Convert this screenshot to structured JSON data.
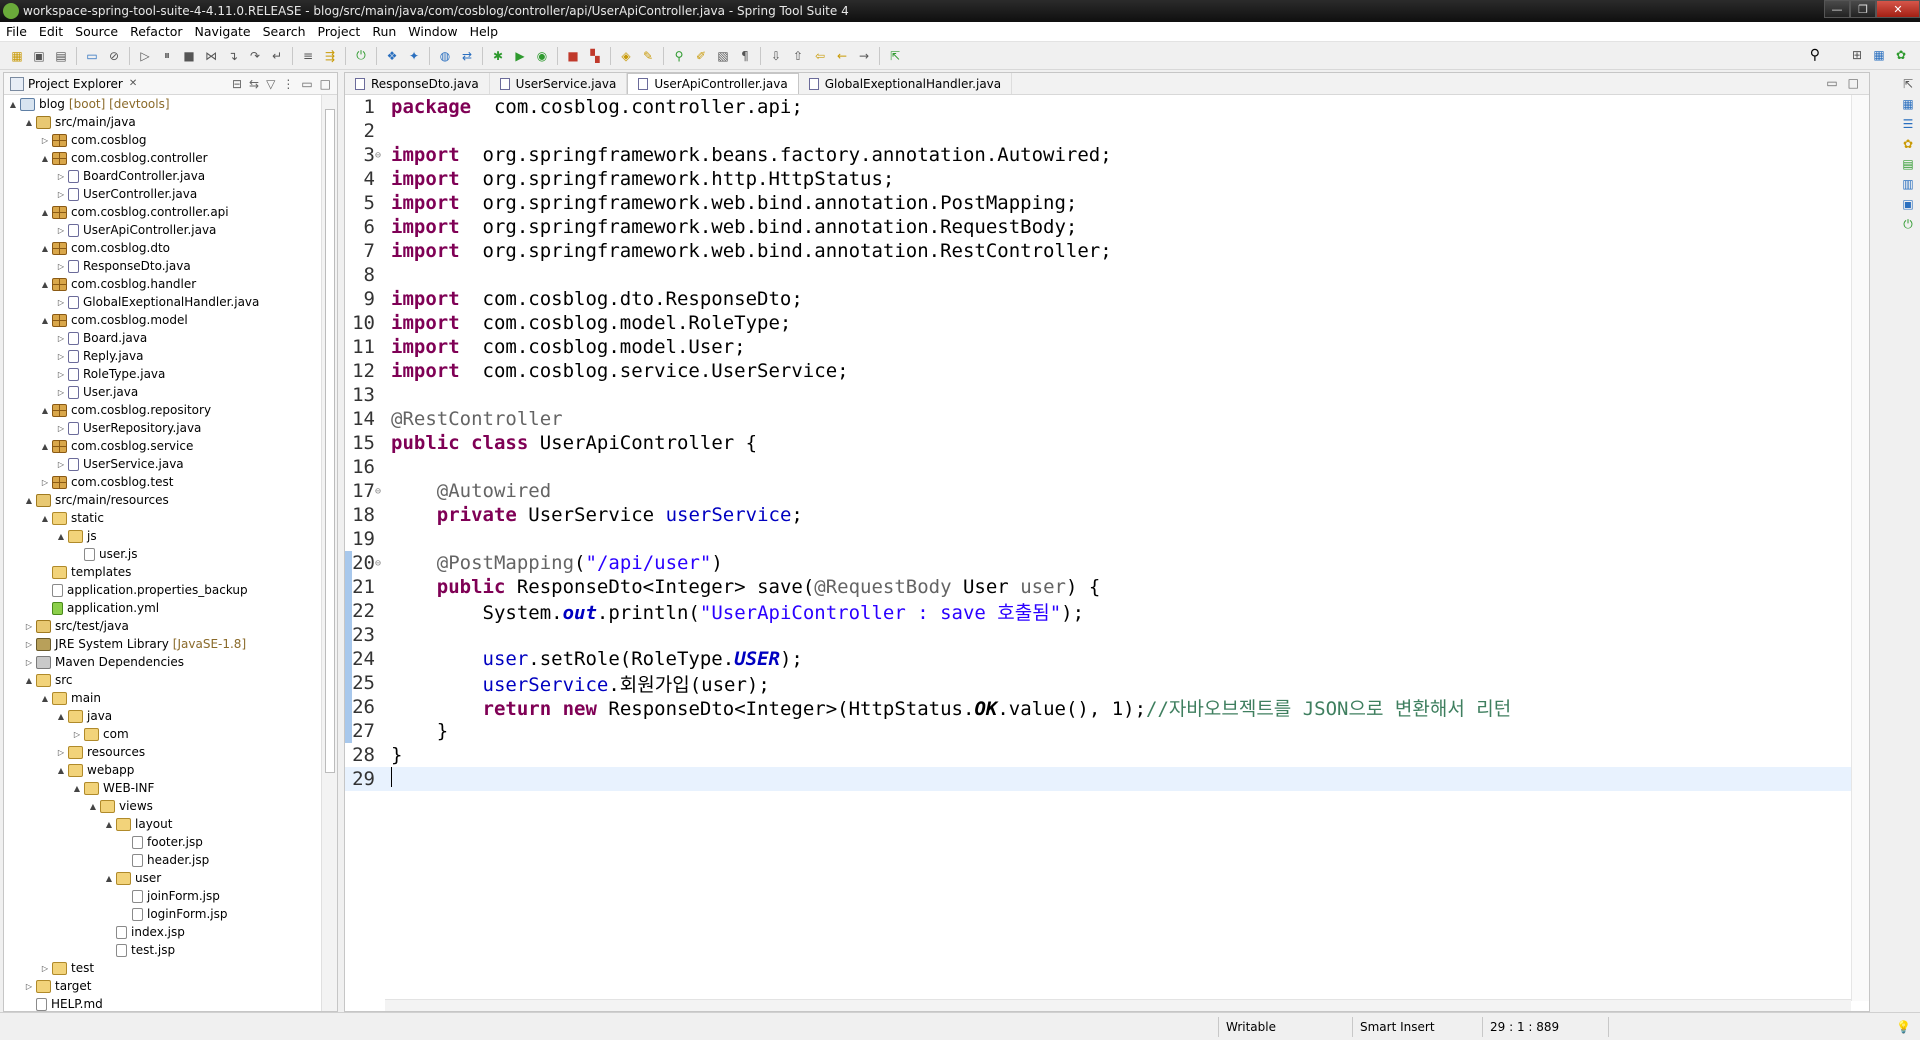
{
  "window": {
    "title": "workspace-spring-tool-suite-4-4.11.0.RELEASE - blog/src/main/java/com/cosblog/controller/api/UserApiController.java - Spring Tool Suite 4",
    "controls": [
      "—",
      "❐",
      "✕"
    ]
  },
  "menu": [
    "File",
    "Edit",
    "Source",
    "Refactor",
    "Navigate",
    "Search",
    "Project",
    "Run",
    "Window",
    "Help"
  ],
  "explorer": {
    "title": "Project Explorer",
    "tree": [
      {
        "d": 0,
        "t": "▲",
        "i": "project",
        "l": "blog",
        "deco": "[boot] [devtools]"
      },
      {
        "d": 1,
        "t": "▲",
        "i": "srcfolder",
        "l": "src/main/java"
      },
      {
        "d": 2,
        "t": "▷",
        "i": "package",
        "l": "com.cosblog"
      },
      {
        "d": 2,
        "t": "▲",
        "i": "package",
        "l": "com.cosblog.controller"
      },
      {
        "d": 3,
        "t": "▷",
        "i": "java",
        "l": "BoardController.java"
      },
      {
        "d": 3,
        "t": "▷",
        "i": "java",
        "l": "UserController.java"
      },
      {
        "d": 2,
        "t": "▲",
        "i": "package",
        "l": "com.cosblog.controller.api"
      },
      {
        "d": 3,
        "t": "▷",
        "i": "java",
        "l": "UserApiController.java"
      },
      {
        "d": 2,
        "t": "▲",
        "i": "package",
        "l": "com.cosblog.dto"
      },
      {
        "d": 3,
        "t": "▷",
        "i": "java",
        "l": "ResponseDto.java"
      },
      {
        "d": 2,
        "t": "▲",
        "i": "package",
        "l": "com.cosblog.handler"
      },
      {
        "d": 3,
        "t": "▷",
        "i": "java",
        "l": "GlobalExeptionalHandler.java"
      },
      {
        "d": 2,
        "t": "▲",
        "i": "package",
        "l": "com.cosblog.model"
      },
      {
        "d": 3,
        "t": "▷",
        "i": "java",
        "l": "Board.java"
      },
      {
        "d": 3,
        "t": "▷",
        "i": "java",
        "l": "Reply.java"
      },
      {
        "d": 3,
        "t": "▷",
        "i": "java",
        "l": "RoleType.java"
      },
      {
        "d": 3,
        "t": "▷",
        "i": "java",
        "l": "User.java"
      },
      {
        "d": 2,
        "t": "▲",
        "i": "package",
        "l": "com.cosblog.repository"
      },
      {
        "d": 3,
        "t": "▷",
        "i": "java",
        "l": "UserRepository.java"
      },
      {
        "d": 2,
        "t": "▲",
        "i": "package",
        "l": "com.cosblog.service"
      },
      {
        "d": 3,
        "t": "▷",
        "i": "java",
        "l": "UserService.java"
      },
      {
        "d": 2,
        "t": "▷",
        "i": "package",
        "l": "com.cosblog.test"
      },
      {
        "d": 1,
        "t": "▲",
        "i": "srcfolder",
        "l": "src/main/resources"
      },
      {
        "d": 2,
        "t": "▲",
        "i": "folder",
        "l": "static"
      },
      {
        "d": 3,
        "t": "▲",
        "i": "folder",
        "l": "js"
      },
      {
        "d": 4,
        "t": "",
        "i": "file",
        "l": "user.js"
      },
      {
        "d": 2,
        "t": "",
        "i": "folder",
        "l": "templates"
      },
      {
        "d": 2,
        "t": "",
        "i": "file",
        "l": "application.properties_backup"
      },
      {
        "d": 2,
        "t": "",
        "i": "yml",
        "l": "application.yml"
      },
      {
        "d": 1,
        "t": "▷",
        "i": "srcfolder",
        "l": "src/test/java"
      },
      {
        "d": 1,
        "t": "▷",
        "i": "lib",
        "l": "JRE System Library",
        "deco": "[JavaSE-1.8]"
      },
      {
        "d": 1,
        "t": "▷",
        "i": "maven",
        "l": "Maven Dependencies"
      },
      {
        "d": 1,
        "t": "▲",
        "i": "folder",
        "l": "src"
      },
      {
        "d": 2,
        "t": "▲",
        "i": "folder",
        "l": "main"
      },
      {
        "d": 3,
        "t": "▲",
        "i": "folder",
        "l": "java"
      },
      {
        "d": 4,
        "t": "▷",
        "i": "folder",
        "l": "com"
      },
      {
        "d": 3,
        "t": "▷",
        "i": "folder",
        "l": "resources"
      },
      {
        "d": 3,
        "t": "▲",
        "i": "folder",
        "l": "webapp"
      },
      {
        "d": 4,
        "t": "▲",
        "i": "folder",
        "l": "WEB-INF"
      },
      {
        "d": 5,
        "t": "▲",
        "i": "folder",
        "l": "views"
      },
      {
        "d": 6,
        "t": "▲",
        "i": "folder",
        "l": "layout"
      },
      {
        "d": 7,
        "t": "",
        "i": "file",
        "l": "footer.jsp"
      },
      {
        "d": 7,
        "t": "",
        "i": "file",
        "l": "header.jsp"
      },
      {
        "d": 6,
        "t": "▲",
        "i": "folder",
        "l": "user"
      },
      {
        "d": 7,
        "t": "",
        "i": "file",
        "l": "joinForm.jsp"
      },
      {
        "d": 7,
        "t": "",
        "i": "file",
        "l": "loginForm.jsp"
      },
      {
        "d": 6,
        "t": "",
        "i": "file",
        "l": "index.jsp"
      },
      {
        "d": 6,
        "t": "",
        "i": "file",
        "l": "test.jsp"
      },
      {
        "d": 2,
        "t": "▷",
        "i": "folder",
        "l": "test"
      },
      {
        "d": 1,
        "t": "▷",
        "i": "folder",
        "l": "target"
      },
      {
        "d": 1,
        "t": "",
        "i": "file",
        "l": "HELP.md"
      }
    ]
  },
  "editor": {
    "tabs": [
      "ResponseDto.java",
      "UserService.java",
      "UserApiController.java",
      "GlobalExeptionalHandler.java"
    ],
    "active_tab": 2,
    "lines": [
      [
        [
          "kw",
          "package"
        ],
        [
          "",
          "  com.cosblog.controller.api;"
        ]
      ],
      [],
      [
        [
          "kw",
          "import"
        ],
        [
          "",
          "  org.springframework.beans.factory.annotation.Autowired;"
        ]
      ],
      [
        [
          "kw",
          "import"
        ],
        [
          "",
          "  org.springframework.http.HttpStatus;"
        ]
      ],
      [
        [
          "kw",
          "import"
        ],
        [
          "",
          "  org.springframework.web.bind.annotation.PostMapping;"
        ]
      ],
      [
        [
          "kw",
          "import"
        ],
        [
          "",
          "  org.springframework.web.bind.annotation.RequestBody;"
        ]
      ],
      [
        [
          "kw",
          "import"
        ],
        [
          "",
          "  org.springframework.web.bind.annotation.RestController;"
        ]
      ],
      [],
      [
        [
          "kw",
          "import"
        ],
        [
          "",
          "  com.cosblog.dto.ResponseDto;"
        ]
      ],
      [
        [
          "kw",
          "import"
        ],
        [
          "",
          "  com.cosblog.model.RoleType;"
        ]
      ],
      [
        [
          "kw",
          "import"
        ],
        [
          "",
          "  com.cosblog.model.User;"
        ]
      ],
      [
        [
          "kw",
          "import"
        ],
        [
          "",
          "  com.cosblog.service.UserService;"
        ]
      ],
      [],
      [
        [
          "an",
          "@RestController"
        ]
      ],
      [
        [
          "kw",
          "public"
        ],
        [
          "",
          " "
        ],
        [
          "kw",
          "class"
        ],
        [
          "",
          " UserApiController {"
        ]
      ],
      [],
      [
        [
          "",
          "    "
        ],
        [
          "an",
          "@Autowired"
        ]
      ],
      [
        [
          "",
          "    "
        ],
        [
          "kw",
          "private"
        ],
        [
          "",
          " UserService "
        ],
        [
          "fld",
          "userService"
        ],
        [
          "",
          ";"
        ]
      ],
      [],
      [
        [
          "",
          "    "
        ],
        [
          "an",
          "@PostMapping"
        ],
        [
          "",
          "("
        ],
        [
          "str",
          "\"/api/user\""
        ],
        [
          "",
          ")"
        ]
      ],
      [
        [
          "",
          "    "
        ],
        [
          "kw",
          "public"
        ],
        [
          "",
          " ResponseDto<Integer> save("
        ],
        [
          "an",
          "@RequestBody"
        ],
        [
          "",
          " User "
        ],
        [
          "an",
          "user"
        ],
        [
          "",
          ") {"
        ]
      ],
      [
        [
          "",
          "        System."
        ],
        [
          "sf",
          "out"
        ],
        [
          "",
          ".println("
        ],
        [
          "str",
          "\"UserApiController : save 호출됨\""
        ],
        [
          "",
          ");"
        ]
      ],
      [],
      [
        [
          "",
          "        "
        ],
        [
          "fld",
          "user"
        ],
        [
          "",
          ".setRole(RoleType."
        ],
        [
          "sf",
          "USER"
        ],
        [
          "",
          ");"
        ]
      ],
      [
        [
          "",
          "        "
        ],
        [
          "fld",
          "userService"
        ],
        [
          "",
          ".회원가입(user);"
        ]
      ],
      [
        [
          "",
          "        "
        ],
        [
          "kw",
          "return"
        ],
        [
          "",
          " "
        ],
        [
          "kw",
          "new"
        ],
        [
          "",
          " ResponseDto<Integer>(HttpStatus."
        ],
        [
          "sm",
          "OK"
        ],
        [
          "",
          ".value(), 1);"
        ],
        [
          "cm",
          "//자바오브젝트를 JSON으로 변환해서 리턴"
        ]
      ],
      [
        [
          "",
          "    }"
        ]
      ],
      [
        [
          "",
          "}"
        ]
      ],
      []
    ],
    "fold_lines": [
      3,
      17,
      20
    ],
    "changed_lines": [
      20,
      27
    ],
    "current_line": 29
  },
  "status": {
    "mode": "Writable",
    "insert": "Smart Insert",
    "position": "29 : 1 : 889"
  }
}
